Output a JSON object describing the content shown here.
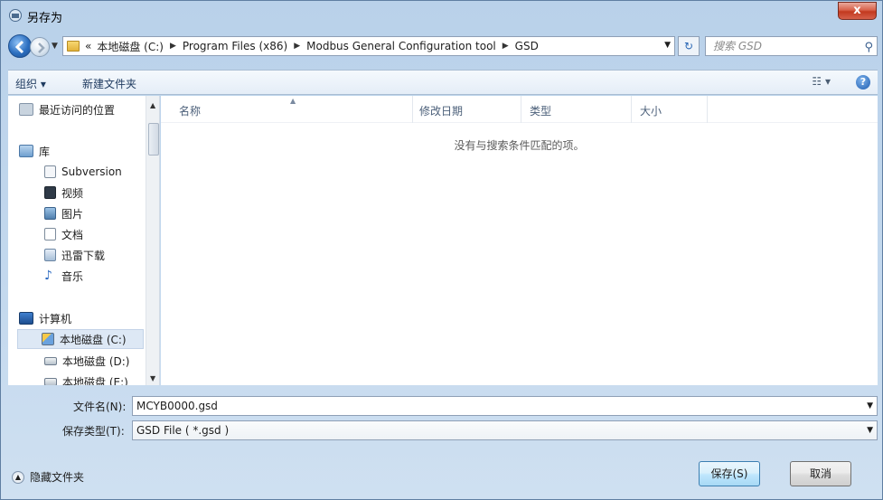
{
  "window": {
    "title": "另存为",
    "close_label": "x"
  },
  "address": {
    "prefix": "«",
    "crumbs": [
      "本地磁盘 (C:)",
      "Program Files (x86)",
      "Modbus General Configuration tool",
      "GSD"
    ],
    "search_placeholder": "搜索 GSD"
  },
  "toolbar": {
    "organize_label": "组织 ▾",
    "new_folder_label": "新建文件夹",
    "help_label": "?"
  },
  "nav": {
    "items": [
      {
        "label": "最近访问的位置",
        "icon": "recent-places-icon"
      },
      {
        "label": "库",
        "icon": "library-icon"
      },
      {
        "label": "Subversion",
        "icon": "document-library-icon"
      },
      {
        "label": "视频",
        "icon": "video-icon"
      },
      {
        "label": "图片",
        "icon": "picture-icon"
      },
      {
        "label": "文档",
        "icon": "document-icon"
      },
      {
        "label": "迅雷下载",
        "icon": "download-library-icon"
      },
      {
        "label": "音乐",
        "icon": "music-icon"
      },
      {
        "label": "计算机",
        "icon": "computer-icon"
      },
      {
        "label": "本地磁盘 (C:)",
        "icon": "system-drive-icon"
      },
      {
        "label": "本地磁盘 (D:)",
        "icon": "drive-icon"
      },
      {
        "label": "本地磁盘 (E:)",
        "icon": "drive-icon"
      }
    ]
  },
  "file_list": {
    "columns": [
      "名称",
      "修改日期",
      "类型",
      "大小"
    ],
    "empty_message": "没有与搜索条件匹配的项。"
  },
  "form": {
    "filename_label": "文件名(N):",
    "filename_value": "MCYB0000.gsd",
    "filetype_label": "保存类型(T):",
    "filetype_value": "GSD File ( *.gsd )"
  },
  "footer": {
    "hide_folders_label": "隐藏文件夹",
    "save_label": "保存(S)",
    "cancel_label": "取消"
  },
  "colors": {
    "accent": "#2c6fc0",
    "close": "#c2391f",
    "selected_row": "#dde8f5"
  }
}
